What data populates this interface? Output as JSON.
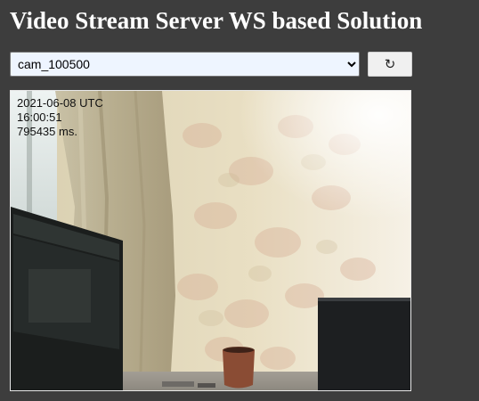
{
  "header": {
    "title": "Video Stream Server WS based Solution"
  },
  "controls": {
    "camera_select": {
      "selected": "cam_100500",
      "options": [
        "cam_100500"
      ]
    },
    "refresh_icon": "refresh-icon",
    "refresh_label": "↻"
  },
  "video": {
    "overlay": {
      "date": "2021-06-08 UTC",
      "time": "16:00:51",
      "ms": "795435 ms."
    }
  }
}
